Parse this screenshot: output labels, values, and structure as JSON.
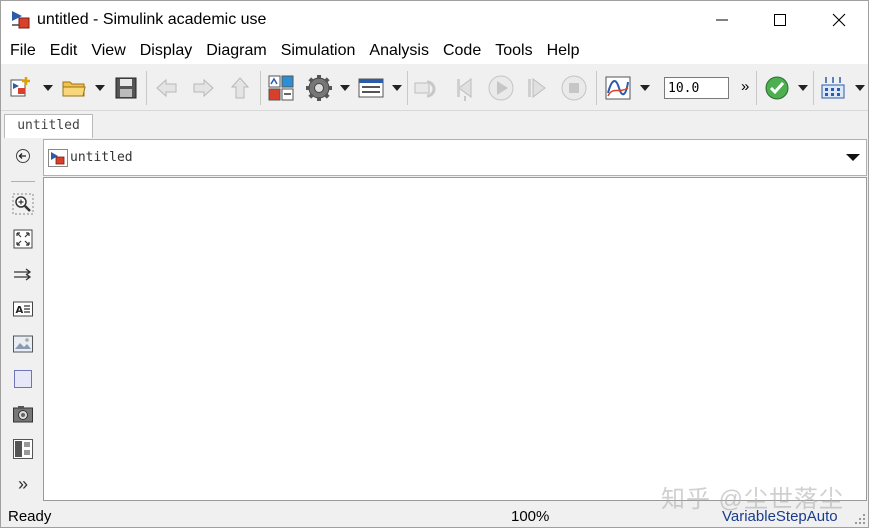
{
  "window": {
    "title": "untitled - Simulink academic use",
    "controls": [
      "minimize",
      "maximize",
      "close"
    ]
  },
  "menu": {
    "items": [
      "File",
      "Edit",
      "View",
      "Display",
      "Diagram",
      "Simulation",
      "Analysis",
      "Code",
      "Tools",
      "Help"
    ]
  },
  "toolbar": {
    "icons": [
      "new-model-icon",
      "open-folder-icon",
      "save-icon",
      "back-arrow-icon",
      "forward-arrow-icon",
      "up-arrow-icon",
      "library-browser-icon",
      "model-config-gear-icon",
      "model-explorer-icon",
      "update-diagram-icon",
      "step-back-icon",
      "run-icon",
      "step-forward-icon",
      "stop-icon",
      "scope-icon",
      "model-advisor-check-icon",
      "build-icon"
    ],
    "stop_time": "10.0",
    "overflow": "»"
  },
  "tabs": [
    {
      "label": "untitled"
    }
  ],
  "explorer": {
    "path": "untitled"
  },
  "palette": {
    "icons": [
      "hide-explorer-icon",
      "zoom-icon",
      "fit-to-view-icon",
      "signal-arrow-icon",
      "annotation-icon",
      "image-icon",
      "area-icon",
      "screenshot-icon",
      "model-browser-icon",
      "more-icon"
    ],
    "more_label": "»"
  },
  "status": {
    "state": "Ready",
    "zoom": "100%",
    "solver": "VariableStepAuto"
  },
  "watermark": "知乎 @尘世落尘",
  "colors": {
    "accent_blue": "#1a3c8c",
    "background": "#f0f0f0",
    "canvas": "#ffffff"
  }
}
